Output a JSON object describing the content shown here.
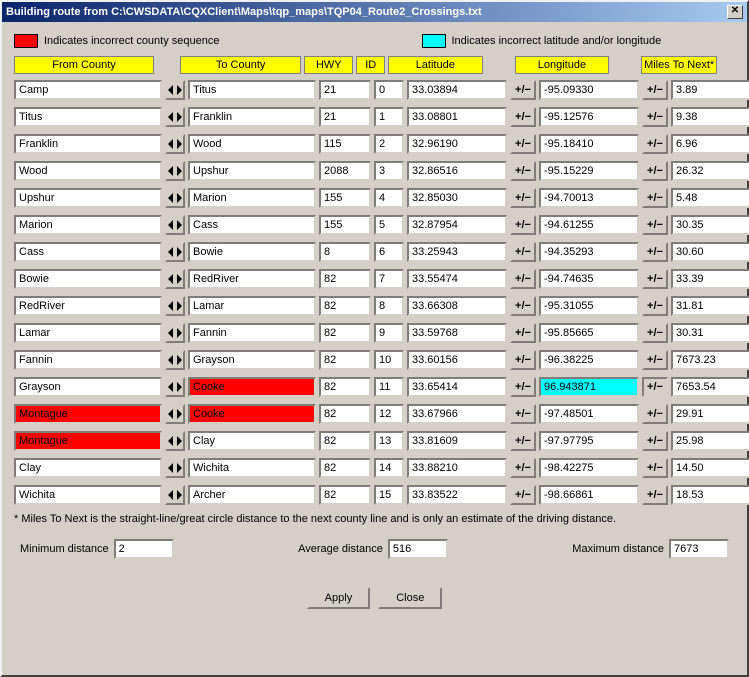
{
  "title": "Building route from C:\\CWSDATA\\CQXClient\\Maps\\tqp_maps\\TQP04_Route2_Crossings.txt",
  "legend": {
    "red": "Indicates incorrect county sequence",
    "cyan": "Indicates incorrect latitude and/or longitude"
  },
  "colors": {
    "red": "#ff0000",
    "cyan": "#00ffff",
    "header": "#ffff00"
  },
  "headers": {
    "from": "From County",
    "to": "To County",
    "hwy": "HWY",
    "id": "ID",
    "lat": "Latitude",
    "lon": "Longitude",
    "mtn": "Miles To Next*"
  },
  "rows": [
    {
      "from": "Camp",
      "to": "Titus",
      "hwy": "21",
      "id": "0",
      "lat": "33.03894",
      "lon": "-95.09330",
      "mtn": "3.89"
    },
    {
      "from": "Titus",
      "to": "Franklin",
      "hwy": "21",
      "id": "1",
      "lat": "33.08801",
      "lon": "-95.12576",
      "mtn": "9.38"
    },
    {
      "from": "Franklin",
      "to": "Wood",
      "hwy": "115",
      "id": "2",
      "lat": "32.96190",
      "lon": "-95.18410",
      "mtn": "6.96"
    },
    {
      "from": "Wood",
      "to": "Upshur",
      "hwy": "2088",
      "id": "3",
      "lat": "32.86516",
      "lon": "-95.15229",
      "mtn": "26.32"
    },
    {
      "from": "Upshur",
      "to": "Marion",
      "hwy": "155",
      "id": "4",
      "lat": "32.85030",
      "lon": "-94.70013",
      "mtn": "5.48"
    },
    {
      "from": "Marion",
      "to": "Cass",
      "hwy": "155",
      "id": "5",
      "lat": "32.87954",
      "lon": "-94.61255",
      "mtn": "30.35"
    },
    {
      "from": "Cass",
      "to": "Bowie",
      "hwy": "8",
      "id": "6",
      "lat": "33.25943",
      "lon": "-94.35293",
      "mtn": "30.60"
    },
    {
      "from": "Bowie",
      "to": "RedRiver",
      "hwy": "82",
      "id": "7",
      "lat": "33.55474",
      "lon": "-94.74635",
      "mtn": "33.39"
    },
    {
      "from": "RedRiver",
      "to": "Lamar",
      "hwy": "82",
      "id": "8",
      "lat": "33.66308",
      "lon": "-95.31055",
      "mtn": "31.81"
    },
    {
      "from": "Lamar",
      "to": "Fannin",
      "hwy": "82",
      "id": "9",
      "lat": "33.59768",
      "lon": "-95.85665",
      "mtn": "30.31"
    },
    {
      "from": "Fannin",
      "to": "Grayson",
      "hwy": "82",
      "id": "10",
      "lat": "33.60156",
      "lon": "-96.38225",
      "mtn": "7673.23"
    },
    {
      "from": "Grayson",
      "to": "Cooke",
      "hwy": "82",
      "id": "11",
      "lat": "33.65414",
      "lon": "96.943871",
      "mtn": "7653.54",
      "to_flag": "red",
      "lon_flag": "cyan",
      "pm_flag": true
    },
    {
      "from": "Montague",
      "to": "Cooke",
      "hwy": "82",
      "id": "12",
      "lat": "33.67966",
      "lon": "-97.48501",
      "mtn": "29.91",
      "from_flag": "red",
      "to_flag": "red"
    },
    {
      "from": "Montague",
      "to": "Clay",
      "hwy": "82",
      "id": "13",
      "lat": "33.81609",
      "lon": "-97.97795",
      "mtn": "25.98",
      "from_flag": "red"
    },
    {
      "from": "Clay",
      "to": "Wichita",
      "hwy": "82",
      "id": "14",
      "lat": "33.88210",
      "lon": "-98.42275",
      "mtn": "14.50"
    },
    {
      "from": "Wichita",
      "to": "Archer",
      "hwy": "82",
      "id": "15",
      "lat": "33.83522",
      "lon": "-98.66861",
      "mtn": "18.53"
    }
  ],
  "footnote": "* Miles To Next is the straight-line/great circle distance to the next county line and is only an estimate of the driving distance.",
  "stats": {
    "min_label": "Minimum distance",
    "min_value": "2",
    "avg_label": "Average distance",
    "avg_value": "516",
    "max_label": "Maximum distance",
    "max_value": "7673"
  },
  "buttons": {
    "apply": "Apply",
    "close": "Close"
  }
}
